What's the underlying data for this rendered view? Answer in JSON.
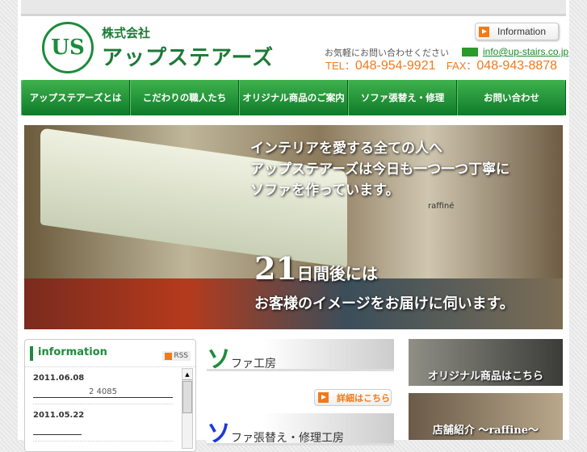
{
  "header": {
    "logo_mark": "US",
    "company_prefix": "株式会社",
    "company_name": "アップステアーズ",
    "info_button": "Information",
    "contact_label": "お気軽にお問い合わせください",
    "email": "info@up-stairs.co.jp",
    "tel_label": "TEL：",
    "tel": "048-954-9921",
    "fax_label": "FAX：",
    "fax": "048-943-8878"
  },
  "nav": [
    "アップステアーズとは",
    "こだわりの職人たち",
    "オリジナル商品のご案内",
    "ソファ張替え・修理",
    "お問い合わせ"
  ],
  "hero": {
    "line1": "インテリアを愛する全ての人へ",
    "line2": "アップステアーズは今日も一つ一つ丁寧に",
    "line3": "ソファを作っています。",
    "days": "21",
    "days_suffix": "日間後には",
    "line5": "お客様のイメージをお届けに伺います。",
    "brand": "raffiné"
  },
  "info": {
    "title": "information",
    "rss": "RSS",
    "entries": [
      {
        "date": "2011.06.08",
        "text": "2 4085"
      },
      {
        "date": "2011.05.22",
        "text": ""
      }
    ]
  },
  "middle": {
    "banner1_big": "ソ",
    "banner1_small": "ファ工房",
    "detail_button": "詳細はこちら",
    "banner2_big": "ソ",
    "banner2_small": "ファ張替え・修理工房"
  },
  "right": {
    "banner1": "オリジナル商品はこちら",
    "banner2": "店舗紹介 ～raffine～"
  }
}
